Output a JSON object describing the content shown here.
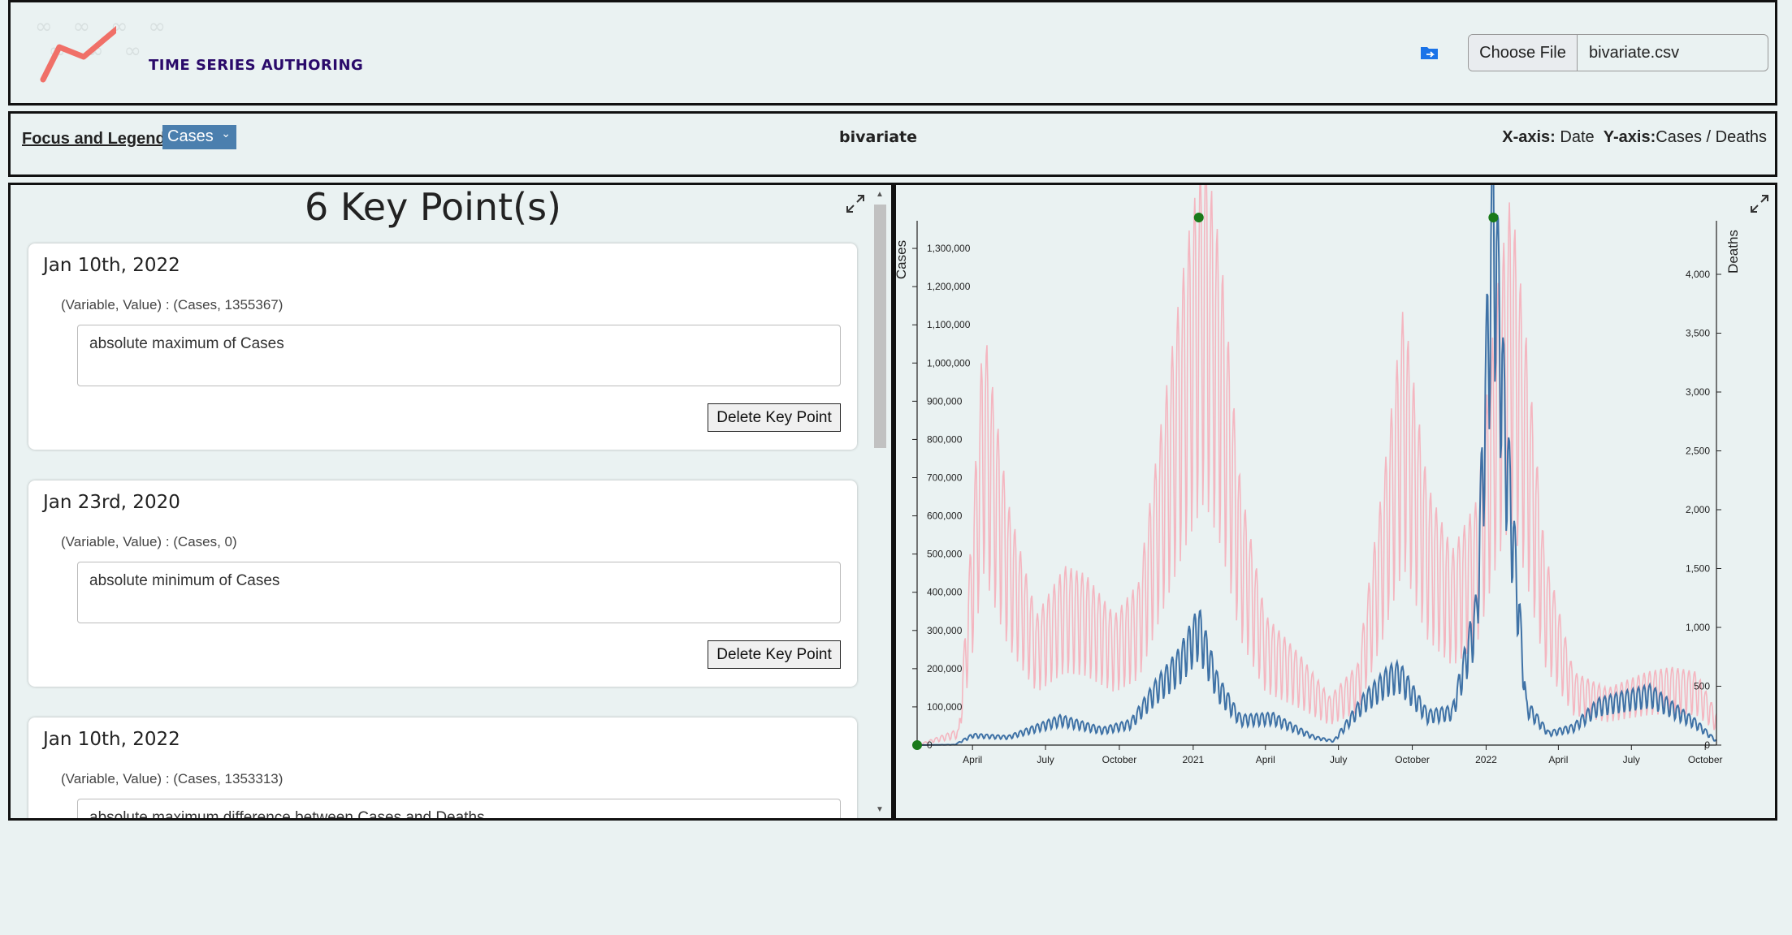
{
  "app": {
    "title": "TIME SERIES AUTHORING"
  },
  "file": {
    "choose_label": "Choose File",
    "file_name": "bivariate.csv"
  },
  "toolbar": {
    "focus_label": "Focus and Legend",
    "focus_selected": "Cases",
    "dataset": "bivariate",
    "x_axis_label": "X-axis:",
    "x_axis_value": "Date",
    "y_axis_label": "Y-axis:",
    "y_axis_value": "Cases / Deaths"
  },
  "keypoints": {
    "title": "6 Key Point(s)",
    "delete_label": "Delete Key Point",
    "cards": [
      {
        "date": "Jan 10th, 2022",
        "var_value": "(Variable, Value) : (Cases, 1355367)",
        "note": "absolute maximum of Cases"
      },
      {
        "date": "Jan 23rd, 2020",
        "var_value": "(Variable, Value) : (Cases, 0)",
        "note": "absolute minimum of Cases"
      },
      {
        "date": "Jan 10th, 2022",
        "var_value": "(Variable, Value) : (Cases, 1353313)",
        "note": "absolute maximum difference between Cases and Deaths"
      }
    ]
  },
  "chart_data": {
    "type": "line",
    "left_axis_label": "Cases",
    "right_axis_label": "Deaths",
    "x_range": [
      "2020-01-23",
      "2022-10-15"
    ],
    "left_ylim": [
      0,
      1355367
    ],
    "right_ylim": [
      0,
      4400
    ],
    "x_ticks": [
      "April",
      "July",
      "October",
      "2021",
      "April",
      "July",
      "October",
      "2022",
      "April",
      "July",
      "October"
    ],
    "x_tick_dates": [
      "2020-04-01",
      "2020-07-01",
      "2020-10-01",
      "2021-01-01",
      "2021-04-01",
      "2021-07-01",
      "2021-10-01",
      "2022-01-01",
      "2022-04-01",
      "2022-07-01",
      "2022-10-01"
    ],
    "left_ticks": [
      0,
      100000,
      200000,
      300000,
      400000,
      500000,
      600000,
      700000,
      800000,
      900000,
      1000000,
      1100000,
      1200000,
      1300000
    ],
    "left_tick_labels": [
      "0",
      "100,000",
      "200,000",
      "300,000",
      "400,000",
      "500,000",
      "600,000",
      "700,000",
      "800,000",
      "900,000",
      "1,000,000",
      "1,100,000",
      "1,200,000",
      "1,300,000"
    ],
    "right_ticks": [
      0,
      500,
      1000,
      1500,
      2000,
      2500,
      3000,
      3500,
      4000
    ],
    "right_tick_labels": [
      "0",
      "500",
      "1,000",
      "1,500",
      "2,000",
      "2,500",
      "3,000",
      "3,500",
      "4,000"
    ],
    "series": [
      {
        "name": "Cases",
        "color": "#3f72a6",
        "axis": "left",
        "anchors": [
          [
            "2020-01-23",
            0
          ],
          [
            "2020-03-10",
            1000
          ],
          [
            "2020-04-01",
            25000
          ],
          [
            "2020-05-15",
            20000
          ],
          [
            "2020-07-20",
            65000
          ],
          [
            "2020-09-10",
            38000
          ],
          [
            "2020-10-15",
            55000
          ],
          [
            "2020-11-15",
            140000
          ],
          [
            "2020-12-15",
            210000
          ],
          [
            "2021-01-08",
            300000
          ],
          [
            "2021-02-01",
            150000
          ],
          [
            "2021-03-01",
            65000
          ],
          [
            "2021-04-10",
            70000
          ],
          [
            "2021-06-01",
            20000
          ],
          [
            "2021-06-25",
            10000
          ],
          [
            "2021-08-01",
            110000
          ],
          [
            "2021-09-01",
            170000
          ],
          [
            "2021-09-15",
            180000
          ],
          [
            "2021-10-20",
            75000
          ],
          [
            "2021-11-20",
            85000
          ],
          [
            "2021-12-20",
            330000
          ],
          [
            "2022-01-10",
            1355367
          ],
          [
            "2022-01-25",
            780000
          ],
          [
            "2022-02-20",
            100000
          ],
          [
            "2022-03-20",
            30000
          ],
          [
            "2022-04-20",
            45000
          ],
          [
            "2022-05-20",
            100000
          ],
          [
            "2022-06-20",
            115000
          ],
          [
            "2022-07-25",
            130000
          ],
          [
            "2022-08-20",
            95000
          ],
          [
            "2022-09-20",
            55000
          ],
          [
            "2022-10-15",
            10000
          ]
        ],
        "weekly_amplitude": 0.32
      },
      {
        "name": "Deaths",
        "color": "#f4b6c0",
        "axis": "right",
        "anchors": [
          [
            "2020-01-23",
            0
          ],
          [
            "2020-03-15",
            100
          ],
          [
            "2020-04-01",
            1400
          ],
          [
            "2020-04-15",
            2600
          ],
          [
            "2020-05-15",
            1500
          ],
          [
            "2020-06-20",
            800
          ],
          [
            "2020-07-25",
            1100
          ],
          [
            "2020-08-20",
            1050
          ],
          [
            "2020-09-25",
            800
          ],
          [
            "2020-10-25",
            1000
          ],
          [
            "2020-11-20",
            1900
          ],
          [
            "2020-12-25",
            3100
          ],
          [
            "2021-01-15",
            3700
          ],
          [
            "2021-02-05",
            3000
          ],
          [
            "2021-03-01",
            1600
          ],
          [
            "2021-04-01",
            800
          ],
          [
            "2021-05-15",
            550
          ],
          [
            "2021-06-20",
            300
          ],
          [
            "2021-07-25",
            500
          ],
          [
            "2021-08-25",
            1600
          ],
          [
            "2021-09-20",
            2700
          ],
          [
            "2021-10-20",
            1600
          ],
          [
            "2021-11-20",
            1200
          ],
          [
            "2021-12-20",
            1500
          ],
          [
            "2022-01-15",
            2800
          ],
          [
            "2022-02-01",
            3400
          ],
          [
            "2022-02-20",
            2500
          ],
          [
            "2022-03-15",
            1200
          ],
          [
            "2022-04-20",
            450
          ],
          [
            "2022-06-01",
            350
          ],
          [
            "2022-07-20",
            450
          ],
          [
            "2022-08-20",
            480
          ],
          [
            "2022-09-20",
            450
          ],
          [
            "2022-10-15",
            200
          ]
        ],
        "weekly_amplitude": 0.55
      }
    ],
    "key_markers": [
      {
        "date": "2020-01-23",
        "series": "Cases",
        "value": 0
      },
      {
        "date": "2021-01-08",
        "series": "Cases",
        "value": 1355367
      },
      {
        "date": "2022-01-10",
        "series": "Cases",
        "value": 1355367
      }
    ],
    "marker_color": "#1a7a1a"
  }
}
